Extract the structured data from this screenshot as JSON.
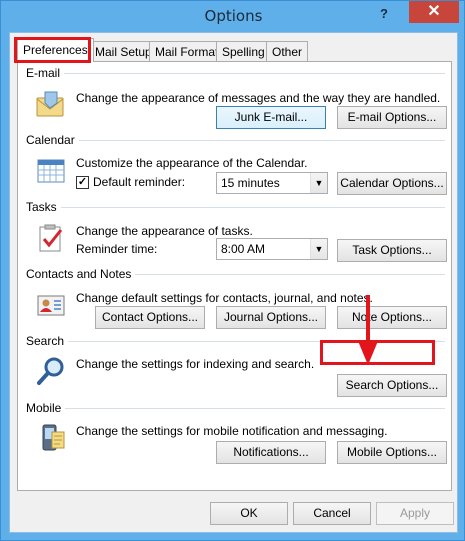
{
  "window": {
    "title": "Options",
    "help_label": "?",
    "close_label": "✕"
  },
  "tabs": [
    {
      "label": "Preferences"
    },
    {
      "label": "Mail Setup"
    },
    {
      "label": "Mail Format"
    },
    {
      "label": "Spelling"
    },
    {
      "label": "Other"
    }
  ],
  "email": {
    "title": "E-mail",
    "description": "Change the appearance of messages and the way they are handled.",
    "junk_button": "Junk E-mail...",
    "options_button": "E-mail Options..."
  },
  "calendar": {
    "title": "Calendar",
    "description": "Customize the appearance of the Calendar.",
    "reminder_label": "Default reminder:",
    "reminder_checked": true,
    "reminder_value": "15 minutes",
    "options_button": "Calendar Options..."
  },
  "tasks": {
    "title": "Tasks",
    "description": "Change the appearance of tasks.",
    "reminder_label": "Reminder time:",
    "reminder_value": "8:00 AM",
    "options_button": "Task Options..."
  },
  "contacts": {
    "title": "Contacts and Notes",
    "description": "Change default settings for contacts, journal, and notes.",
    "contact_button": "Contact Options...",
    "journal_button": "Journal Options...",
    "note_button": "Note Options..."
  },
  "search": {
    "title": "Search",
    "description": "Change the settings for indexing and search.",
    "options_button": "Search Options..."
  },
  "mobile": {
    "title": "Mobile",
    "description": "Change the settings for mobile notification and messaging.",
    "notifications_button": "Notifications...",
    "options_button": "Mobile Options..."
  },
  "footer": {
    "ok": "OK",
    "cancel": "Cancel",
    "apply": "Apply"
  },
  "colors": {
    "highlight": "#e2141c",
    "titlebar": "#5fb0ea",
    "close": "#c7453b"
  }
}
